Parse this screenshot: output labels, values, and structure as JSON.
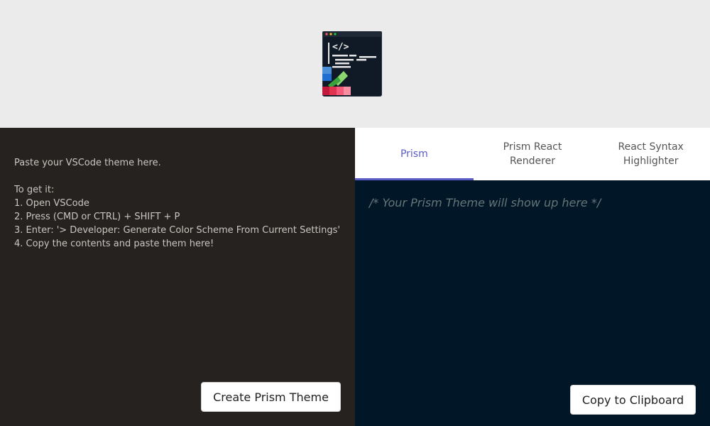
{
  "header": {
    "logo_icon": "code-palette-icon"
  },
  "left": {
    "instructions": "Paste your VSCode theme here.\n\nTo get it:\n1. Open VSCode\n2. Press (CMD or CTRL) + SHIFT + P\n3. Enter: '> Developer: Generate Color Scheme From Current Settings'\n4. Copy the contents and paste them here!",
    "create_button": "Create Prism Theme"
  },
  "right": {
    "tabs": [
      {
        "label": "Prism"
      },
      {
        "label": "Prism React Renderer"
      },
      {
        "label": "React Syntax Highlighter"
      }
    ],
    "output_placeholder": "/* Your Prism Theme will show up here */",
    "copy_button": "Copy to Clipboard"
  },
  "colors": {
    "accent": "#5b5bc8",
    "editor_bg": "#011627",
    "input_bg": "#252220"
  }
}
